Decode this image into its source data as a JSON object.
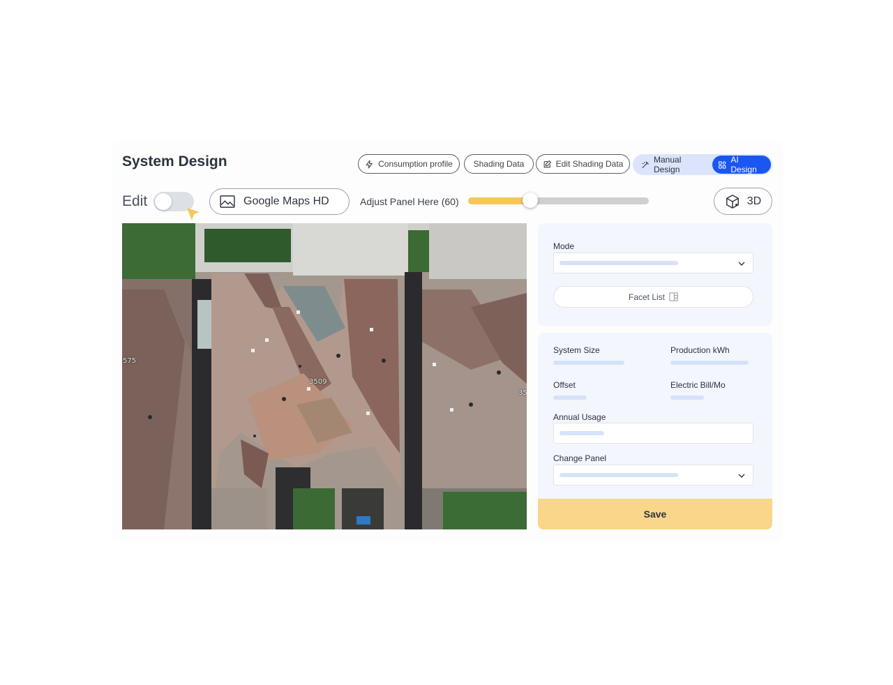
{
  "header": {
    "title": "System Design",
    "buttons": {
      "consumption": "Consumption profile",
      "shading": "Shading Data",
      "edit_shading": "Edit Shading Data"
    },
    "design_mode": {
      "manual": "Manual Design",
      "ai": "AI Design",
      "active": "AI Design"
    }
  },
  "toolbar": {
    "edit_label": "Edit",
    "edit_on": false,
    "map_source": "Google Maps HD",
    "adjust_label": "Adjust Panel Here (60)",
    "slider_value": 60,
    "slider_max": 175,
    "view_3d": "3D"
  },
  "map": {
    "labels": [
      "575",
      "3509",
      "35"
    ]
  },
  "panel": {
    "mode_label": "Mode",
    "facet_list": "Facet List",
    "system_size": "System Size",
    "production": "Production kWh",
    "offset": "Offset",
    "electric_bill": "Electric Bill/Mo",
    "annual_usage": "Annual Usage",
    "change_panel": "Change Panel",
    "save": "Save"
  },
  "colors": {
    "accent": "#1a56f0",
    "slider": "#f6c858",
    "save": "#f9d68a",
    "panel_bg": "#f3f6fc"
  }
}
